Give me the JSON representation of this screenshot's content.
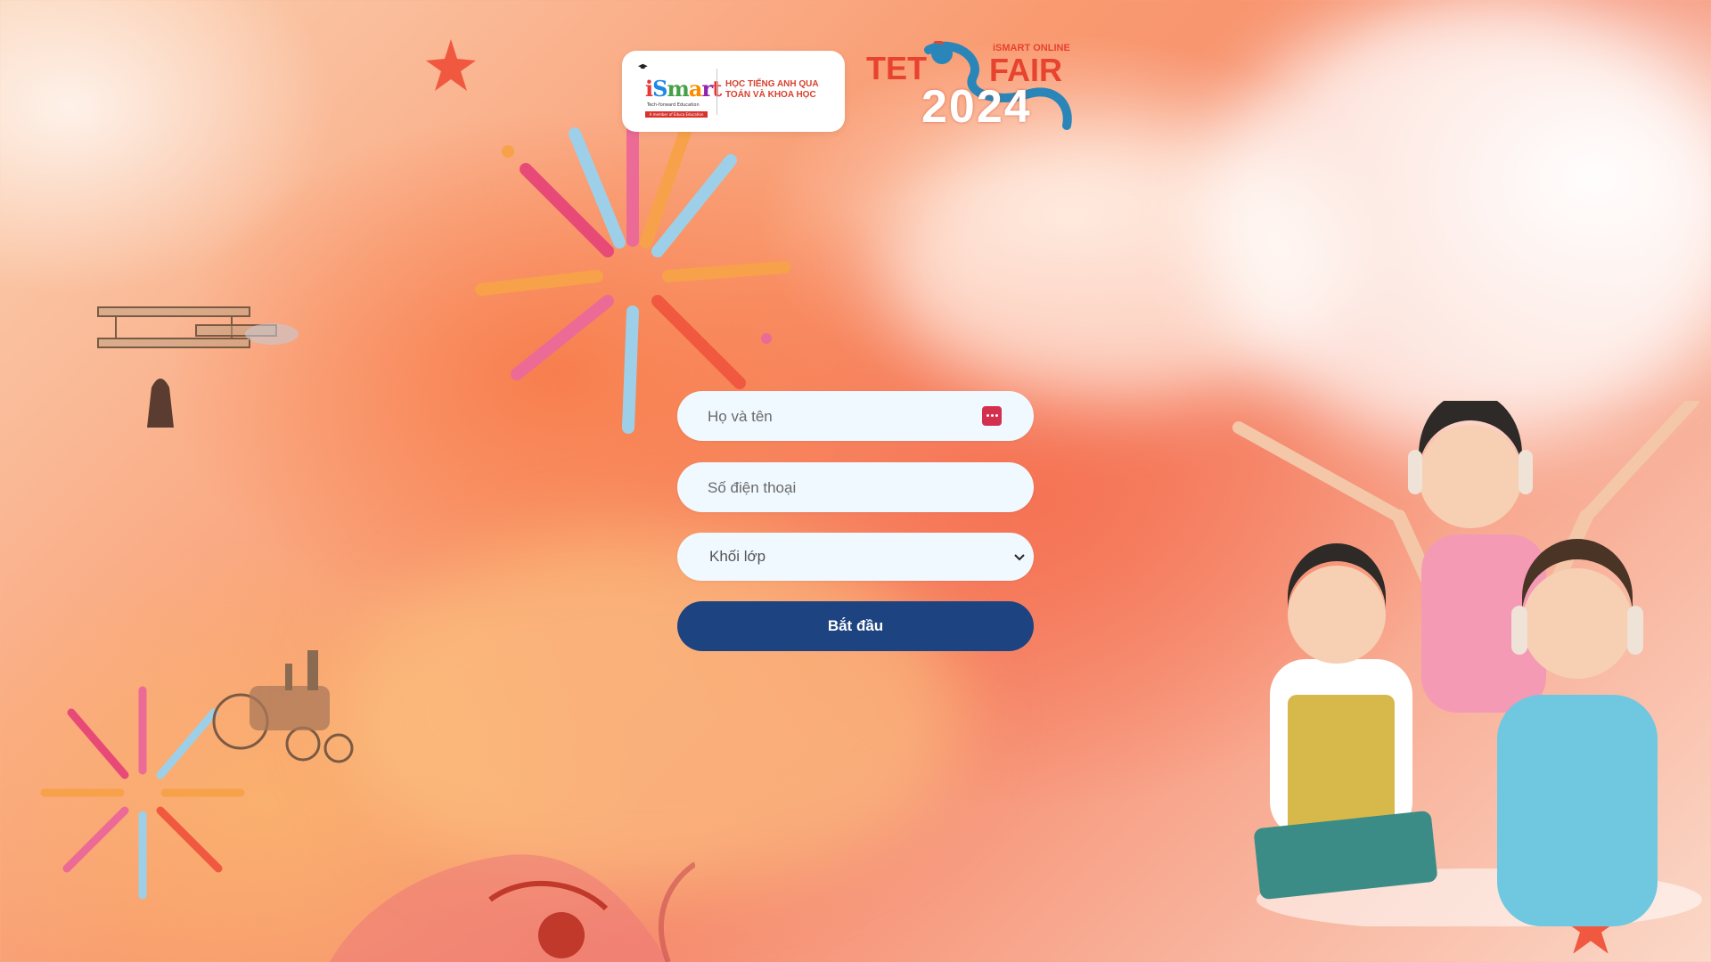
{
  "logo": {
    "brand_letters": [
      "i",
      "S",
      "m",
      "a",
      "r",
      "t"
    ],
    "subtitle": "Tech-forward Education",
    "strip": "A member of Educa Education",
    "tagline": "Học Tiếng Anh qua Toán và Khoa học"
  },
  "event_logo": {
    "tet": "TET",
    "online": "iSMART ONLINE",
    "fair": "FAIR",
    "year": "2024"
  },
  "form": {
    "name_placeholder": "Họ và tên",
    "phone_placeholder": "Số điện thoại",
    "grade_selected": "Khối lớp",
    "start_label": "Bắt đầu"
  },
  "colors": {
    "button": "#1d4480",
    "field_bg": "#f0f9ff",
    "brand_red": "#e8432f"
  },
  "icons": [
    "autofill-key-icon",
    "chevron-down-icon",
    "star-icon",
    "firework-icon",
    "dragon-icon"
  ]
}
